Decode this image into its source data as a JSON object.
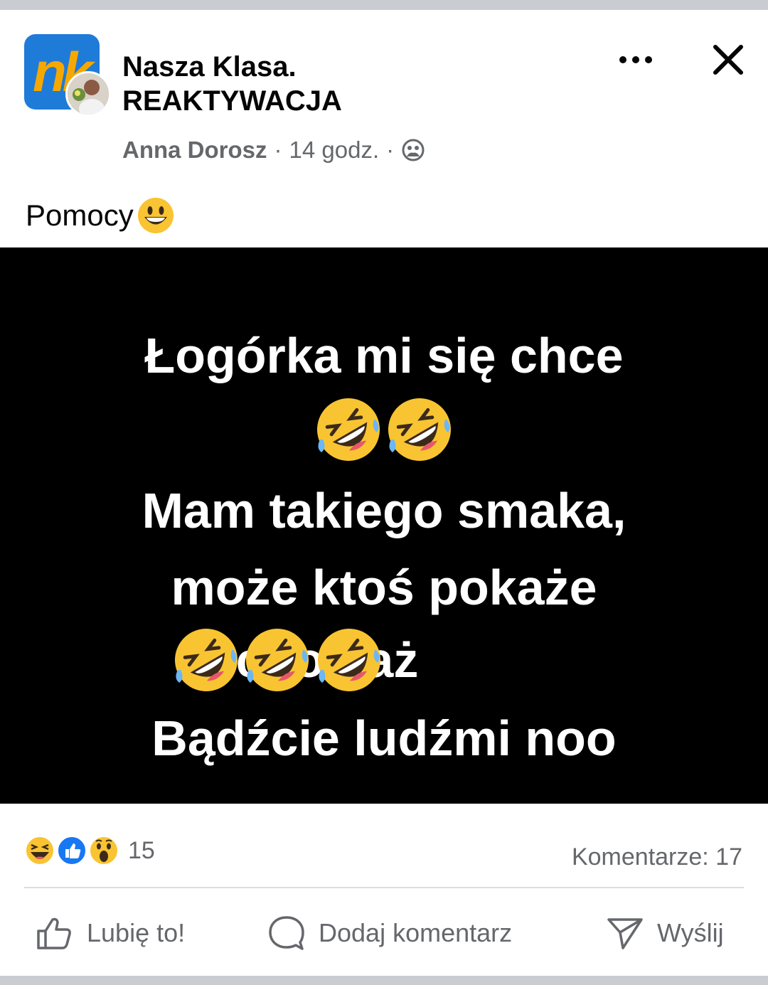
{
  "header": {
    "group_name": "Nasza Klasa. REAKTYWACJA",
    "logo_text": "nk",
    "author": "Anna Dorosz",
    "separator": "·",
    "time": "14 godz.",
    "more_label": "•••",
    "close_label": "✕",
    "privacy_icon": "group-icon"
  },
  "post": {
    "text": "Pomocy",
    "emoji": "grinning-face"
  },
  "image": {
    "lines": [
      "Łogórka mi się chce",
      "Mam takiego smaka,",
      "może ktoś pokaże",
      "chociaż",
      "Bądźcie ludźmi noo"
    ],
    "emoji": "rolling-on-floor-laughing"
  },
  "stats": {
    "reaction_icons": [
      "haha-icon",
      "like-icon",
      "wow-icon"
    ],
    "reaction_count": "15",
    "comments_label": "Komentarze: 17"
  },
  "actions": {
    "like_label": "Lubię to!",
    "comment_label": "Dodaj komentarz",
    "send_label": "Wyślij"
  },
  "colors": {
    "background": "#c9ccd1",
    "card": "#ffffff",
    "secondary_text": "#65676b",
    "image_bg": "#000000",
    "like_blue": "#1877f2"
  }
}
